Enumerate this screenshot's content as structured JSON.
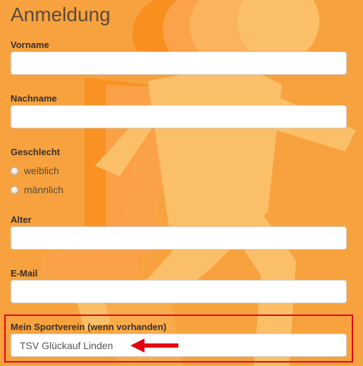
{
  "page": {
    "title": "Anmeldung"
  },
  "fields": {
    "vorname": {
      "label": "Vorname",
      "value": ""
    },
    "nachname": {
      "label": "Nachname",
      "value": ""
    },
    "alter": {
      "label": "Alter",
      "value": ""
    },
    "email": {
      "label": "E-Mail",
      "value": ""
    },
    "sportverein": {
      "label": "Mein Sportverein (wenn vorhanden)",
      "value": "TSV Glückauf Linden"
    }
  },
  "gender": {
    "label": "Geschlecht",
    "options": [
      {
        "label": "weiblich",
        "selected": false
      },
      {
        "label": "männlich",
        "selected": false
      }
    ]
  },
  "colors": {
    "background": "#f7a23e",
    "figure_light": "#fbbf68",
    "figure_mid": "#f98f1f",
    "highlight": "#e30613"
  },
  "icons": {
    "background": "running-figure-icon",
    "annotation": "arrow-left-icon"
  }
}
